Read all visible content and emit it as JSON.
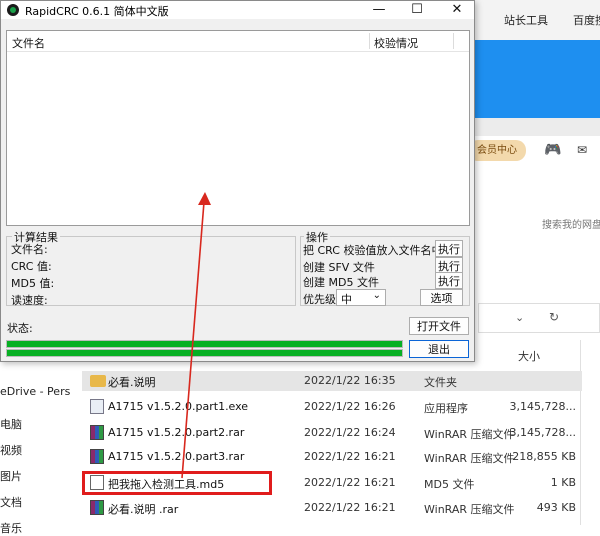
{
  "app": {
    "title": "RapidCRC 0.6.1 简体中文版",
    "window_controls": {
      "minimize": "—",
      "maximize": "☐",
      "close": "✕"
    },
    "columns": {
      "name": "文件名",
      "check": "校验情况"
    },
    "results": {
      "title": "计算结果",
      "labels": [
        "文件名:",
        "CRC 值:",
        "MD5 值:",
        "读速度:"
      ]
    },
    "operations": {
      "title": "操作",
      "rows": [
        {
          "label": "把 CRC 校验值放入文件名中",
          "button": "执行"
        },
        {
          "label": "创建 SFV 文件",
          "button": "执行"
        },
        {
          "label": "创建 MD5 文件",
          "button": "执行"
        }
      ],
      "priority_label": "优先级",
      "priority_value": "中",
      "options_button": "选项"
    },
    "status_label": "状态:",
    "open_button": "打开文件",
    "exit_button": "退出",
    "progress": [
      1.0,
      1.0
    ]
  },
  "browser": {
    "tabs": [
      "站长工具",
      "百度搜"
    ],
    "vip_button": "会员中心",
    "search_link": "搜索我的网盘"
  },
  "explorer": {
    "column_size": "大小",
    "nav_items": [
      "eDrive - Pers",
      "电脑",
      "视频",
      "图片",
      "文档",
      "音乐"
    ],
    "files": [
      {
        "name": "必看.说明",
        "date": "2022/1/22 16:35",
        "type": "文件夹",
        "size": "",
        "icon": "folder-icon"
      },
      {
        "name": "A1715 v1.5.2.0.part1.exe",
        "date": "2022/1/22 16:26",
        "type": "应用程序",
        "size": "3,145,728...",
        "icon": "exe-icon"
      },
      {
        "name": "A1715 v1.5.2.0.part2.rar",
        "date": "2022/1/22 16:24",
        "type": "WinRAR 压缩文件",
        "size": "3,145,728...",
        "icon": "winrar-icon"
      },
      {
        "name": "A1715 v1.5.2.0.part3.rar",
        "date": "2022/1/22 16:21",
        "type": "WinRAR 压缩文件",
        "size": "218,855 KB",
        "icon": "winrar-icon"
      },
      {
        "name": "把我拖入检测工具.md5",
        "date": "2022/1/22 16:21",
        "type": "MD5 文件",
        "size": "1 KB",
        "icon": "document-icon"
      },
      {
        "name": "必看.说明 .rar",
        "date": "2022/1/22 16:21",
        "type": "WinRAR 压缩文件",
        "size": "493 KB",
        "icon": "winrar-icon"
      }
    ]
  },
  "colors": {
    "progress": "#07b023",
    "highlight": "#e01c1c",
    "arrow": "#d8281e"
  }
}
